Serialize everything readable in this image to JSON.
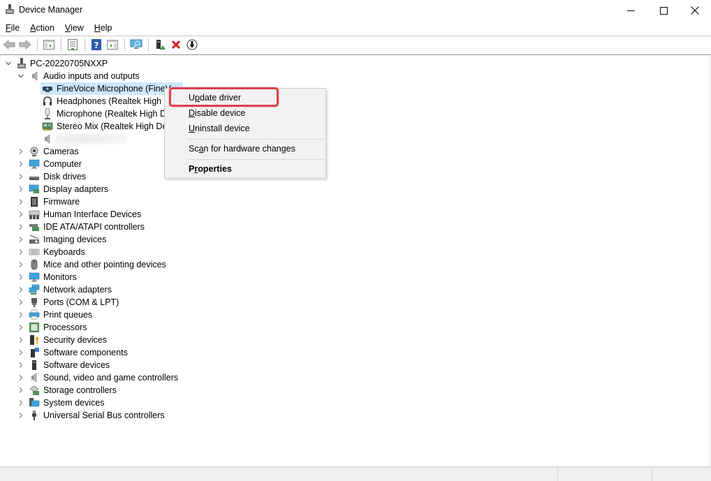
{
  "window": {
    "title": "Device Manager",
    "controls": {
      "minimize": "minimize",
      "maximize": "maximize",
      "close": "close"
    }
  },
  "menubar": {
    "items": [
      {
        "label": "File",
        "accel": "F",
        "rest": "ile"
      },
      {
        "label": "Action",
        "accel": "A",
        "rest": "ction"
      },
      {
        "label": "View",
        "accel": "V",
        "rest": "iew"
      },
      {
        "label": "Help",
        "accel": "H",
        "rest": "elp"
      }
    ]
  },
  "toolbar": {
    "buttons": [
      "back-icon",
      "forward-icon",
      "show-hide-console-tree-icon",
      "properties-icon",
      "help-icon",
      "show-action-pane-icon",
      "scan-hardware-icon",
      "update-driver-icon",
      "uninstall-device-icon",
      "disable-device-icon"
    ]
  },
  "tree": {
    "root": "PC-20220705NXXP",
    "expanded_category": "Audio inputs and outputs",
    "audio_children": [
      {
        "label": "FineVoice Microphone (FineVoice)",
        "visible_label": "FineVoice Microphone (FineV",
        "icon": "webcam-microphone-icon",
        "selected": true
      },
      {
        "label": "Headphones (Realtek High Definition Audio)",
        "visible_label": "Headphones (Realtek High De",
        "icon": "headphones-icon"
      },
      {
        "label": "Microphone (Realtek High Definition Audio)",
        "visible_label": "Microphone (Realtek High De",
        "icon": "microphone-icon"
      },
      {
        "label": "Stereo Mix (Realtek High Definition Audio)",
        "visible_label": "Stereo Mix (Realtek High Defi",
        "icon": "sound-card-icon"
      },
      {
        "label": "",
        "visible_label": "",
        "icon": "speaker-icon",
        "blurred": true
      }
    ],
    "categories": [
      {
        "label": "Cameras",
        "icon": "camera-icon"
      },
      {
        "label": "Computer",
        "icon": "computer-icon"
      },
      {
        "label": "Disk drives",
        "icon": "disk-drive-icon"
      },
      {
        "label": "Display adapters",
        "icon": "display-adapter-icon"
      },
      {
        "label": "Firmware",
        "icon": "firmware-icon"
      },
      {
        "label": "Human Interface Devices",
        "icon": "hid-icon"
      },
      {
        "label": "IDE ATA/ATAPI controllers",
        "icon": "ide-controller-icon"
      },
      {
        "label": "Imaging devices",
        "icon": "imaging-device-icon"
      },
      {
        "label": "Keyboards",
        "icon": "keyboard-icon"
      },
      {
        "label": "Mice and other pointing devices",
        "icon": "mouse-icon"
      },
      {
        "label": "Monitors",
        "icon": "monitor-icon"
      },
      {
        "label": "Network adapters",
        "icon": "network-adapter-icon"
      },
      {
        "label": "Ports (COM & LPT)",
        "icon": "port-icon"
      },
      {
        "label": "Print queues",
        "icon": "printer-icon"
      },
      {
        "label": "Processors",
        "icon": "processor-icon"
      },
      {
        "label": "Security devices",
        "icon": "security-device-icon"
      },
      {
        "label": "Software components",
        "icon": "software-component-icon"
      },
      {
        "label": "Software devices",
        "icon": "software-device-icon"
      },
      {
        "label": "Sound, video and game controllers",
        "icon": "sound-controller-icon"
      },
      {
        "label": "Storage controllers",
        "icon": "storage-controller-icon"
      },
      {
        "label": "System devices",
        "icon": "system-device-icon"
      },
      {
        "label": "Universal Serial Bus controllers",
        "icon": "usb-icon"
      }
    ]
  },
  "context_menu": {
    "items": [
      {
        "label": "Update driver",
        "pre": "U",
        "accel": "p",
        "post": "date driver",
        "highlighted": true
      },
      {
        "label": "Disable device",
        "pre": "",
        "accel": "D",
        "post": "isable device"
      },
      {
        "label": "Uninstall device",
        "pre": "",
        "accel": "U",
        "post": "ninstall device"
      },
      {
        "separator": true
      },
      {
        "label": "Scan for hardware changes",
        "pre": "Sc",
        "accel": "a",
        "post": "n for hardware changes"
      },
      {
        "separator": true
      },
      {
        "label": "Properties",
        "pre": "P",
        "accel": "r",
        "post": "operties",
        "bold": true
      }
    ],
    "highlight_color": "#d9434f"
  },
  "statusbar": {
    "text": ""
  }
}
